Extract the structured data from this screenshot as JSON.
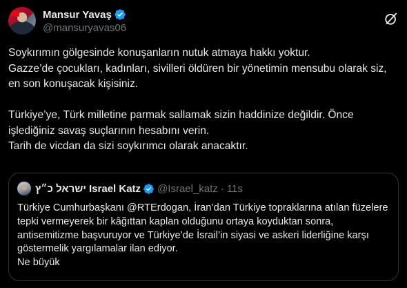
{
  "author": {
    "display_name": "Mansur Yavaş",
    "handle": "@mansuryavas06",
    "verified": true,
    "verified_color": "#1d9bf0"
  },
  "tweet": {
    "text": "Soykırımın gölgesinde konuşanların nutuk atmaya hakkı yoktur.\nGazze’de çocukları, kadınları, sivilleri öldüren bir yönetimin mensubu olarak siz, en son konuşacak kişisiniz.\n\nTürkiye’ye, Türk milletine parmak sallamak sizin haddinize değildir. Önce işlediğiniz savaş suçlarının hesabını verin.\nTarih de vicdan da sizi soykırımcı olarak anacaktır."
  },
  "icons": {
    "grok": "grok-icon",
    "verified": "verified-badge-icon"
  },
  "quote": {
    "display_name": "ישראל כ״ץ Israel Katz",
    "handle": "@Israel_katz",
    "separator": "·",
    "time": "11s",
    "verified": true,
    "text": "Türkiye Cumhurbaşkanı @RTErdogan, İran’dan Türkiye topraklarına atılan füzelere tepki vermeyerek bir kâğıttan kaplan olduğunu ortaya koyduktan sonra, antisemitizme başvuruyor ve Türkiye’de İsrail’in siyasi ve askeri liderliğine karşı göstermelik yargılamalar ilan ediyor.\nNe büyük"
  },
  "colors": {
    "background": "#000000",
    "text": "#e7e9ea",
    "secondary": "#71767b",
    "border": "#2f3336",
    "accent": "#1d9bf0"
  }
}
